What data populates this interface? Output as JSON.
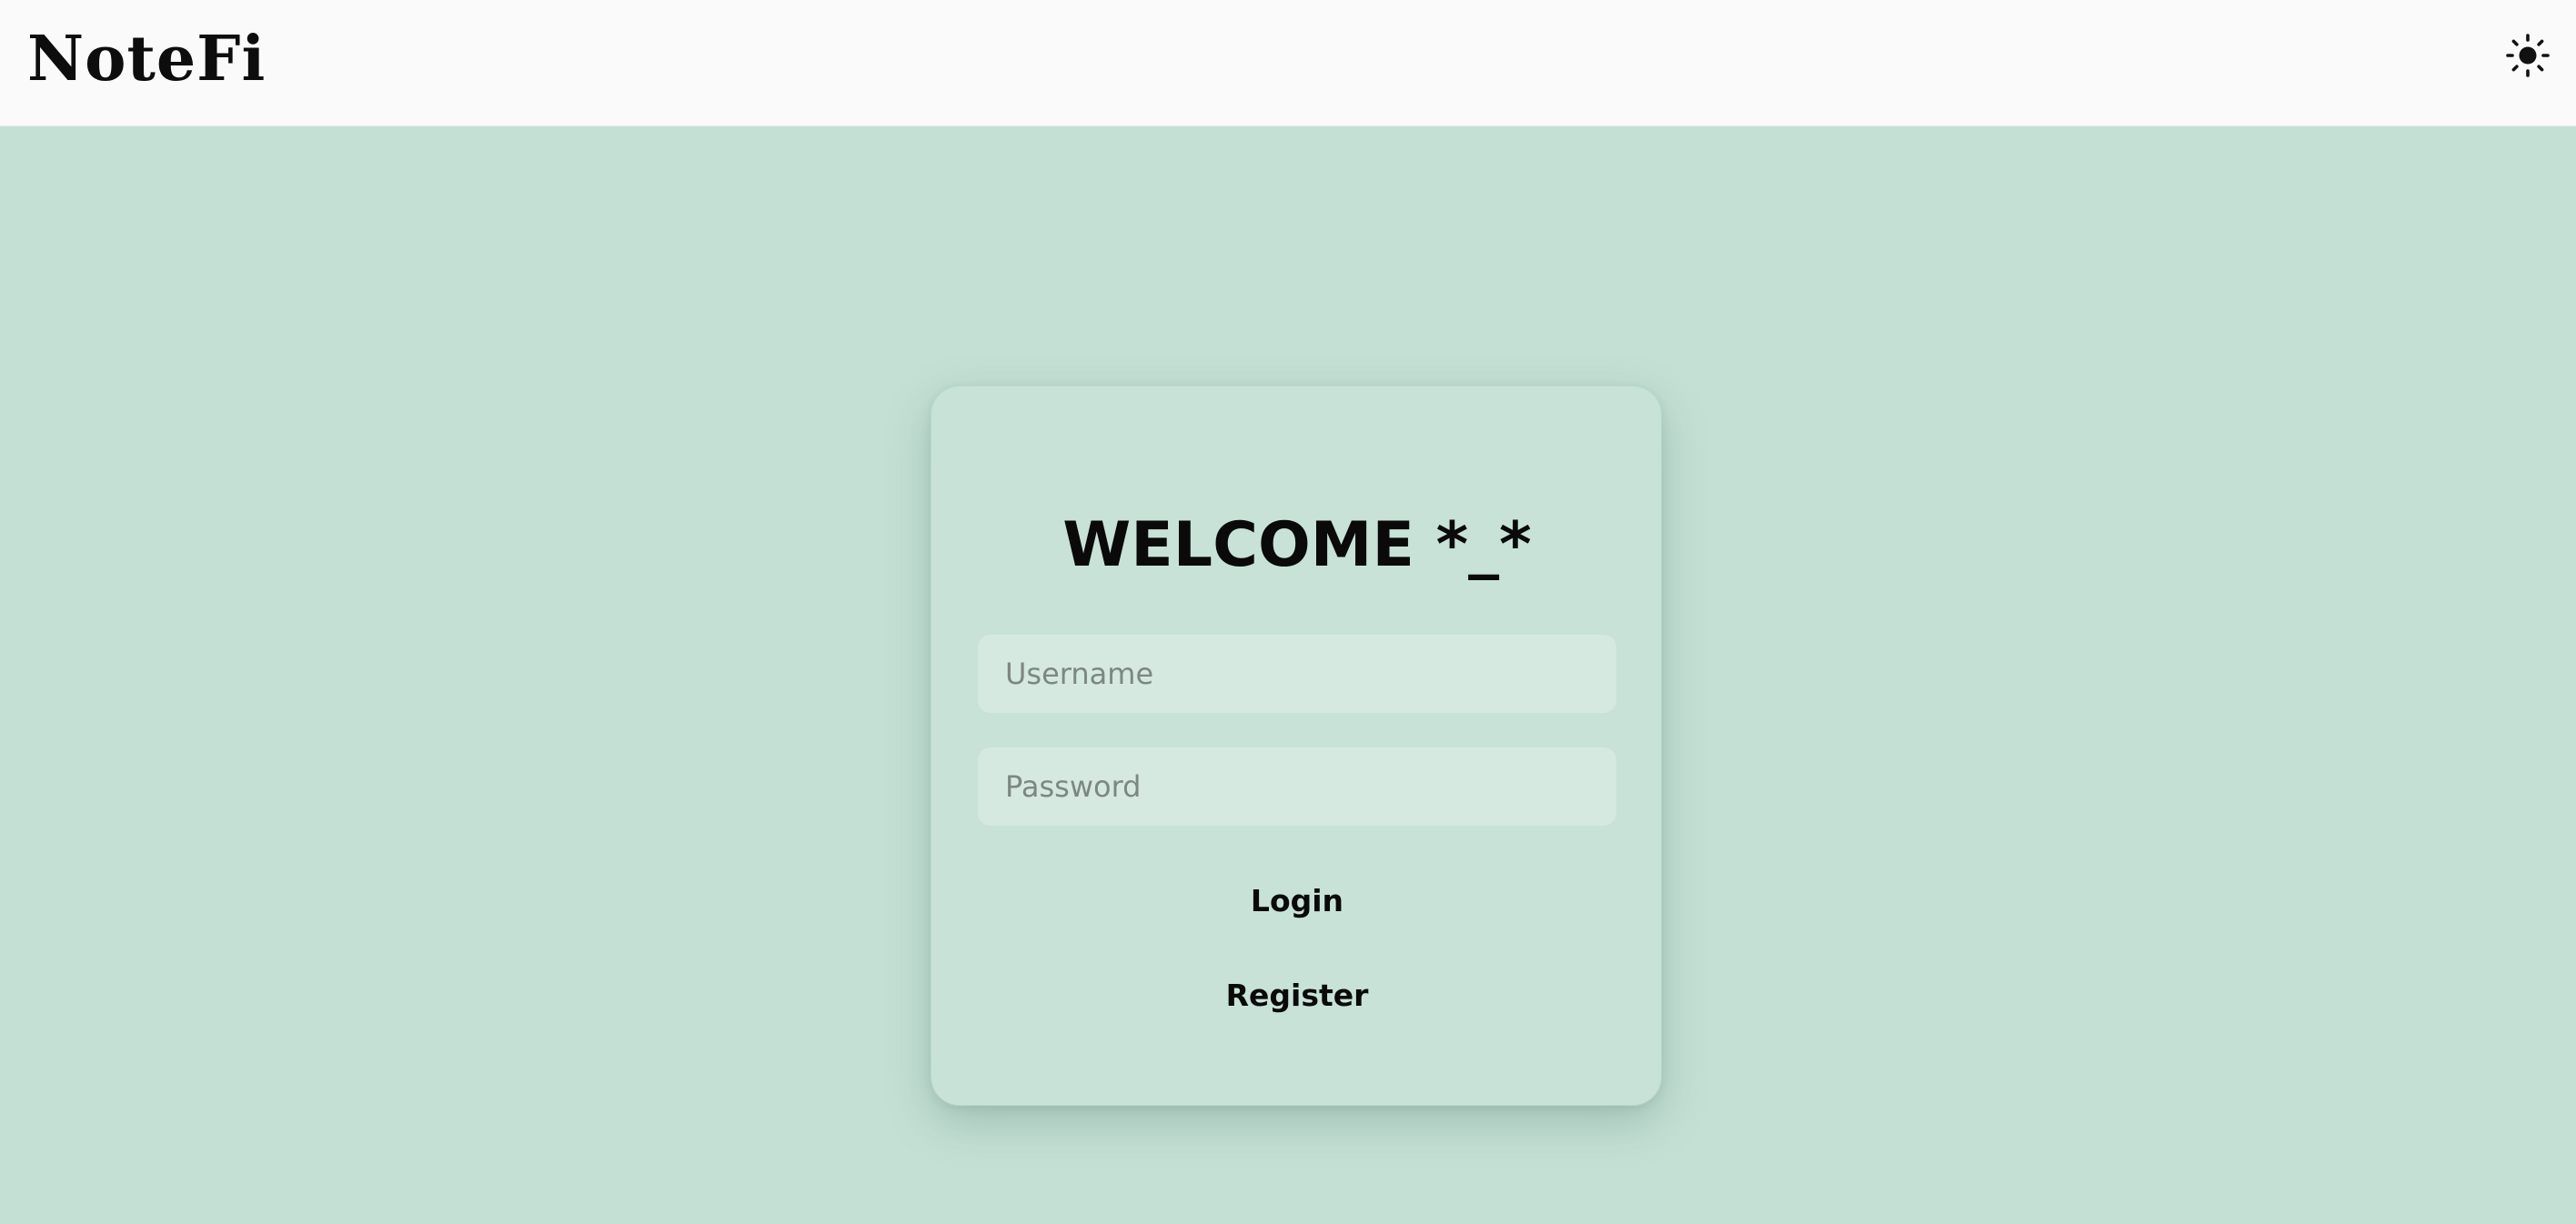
{
  "header": {
    "brand": "NoteFi",
    "theme_icon": "sun-icon"
  },
  "login_card": {
    "heading": "WELCOME *_*",
    "username_placeholder": "Username",
    "username_value": "",
    "password_placeholder": "Password",
    "password_value": "",
    "login_label": "Login",
    "register_label": "Register"
  },
  "colors": {
    "background": "#c4e0d5",
    "header_background": "#fafafa",
    "card_background": "#c8e2d8",
    "input_background": "#d5e9e1",
    "text": "#0a0a0a"
  }
}
